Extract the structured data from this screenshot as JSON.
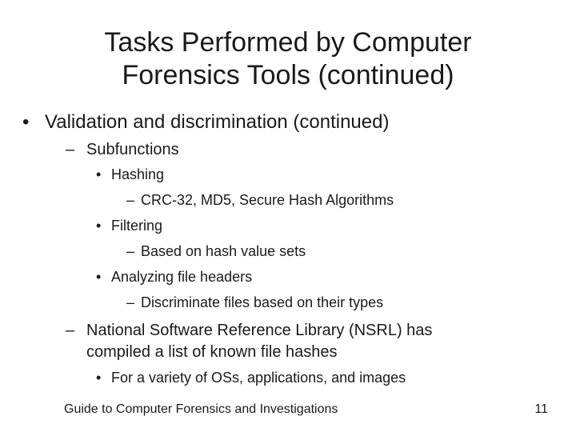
{
  "slide": {
    "title_lines": [
      "Tasks Performed by Computer",
      "Forensics Tools (continued)"
    ],
    "bullets": {
      "b1": {
        "marker": "•",
        "text": "Validation and discrimination (continued)"
      },
      "b1_1": {
        "marker": "–",
        "text": "Subfunctions"
      },
      "b1_1_1": {
        "marker": "•",
        "text": "Hashing"
      },
      "b1_1_1_1": {
        "marker": "–",
        "text": "CRC-32, MD5, Secure Hash Algorithms"
      },
      "b1_1_2": {
        "marker": "•",
        "text": "Filtering"
      },
      "b1_1_2_1": {
        "marker": "–",
        "text": "Based on hash value sets"
      },
      "b1_1_3": {
        "marker": "•",
        "text": "Analyzing file headers"
      },
      "b1_1_3_1": {
        "marker": "–",
        "text": "Discriminate files based on their types"
      },
      "b1_2": {
        "marker": "–",
        "text_lines": [
          "National Software Reference Library (NSRL) has",
          "compiled a list of known file hashes"
        ]
      },
      "b1_2_1": {
        "marker": "•",
        "text": "For a variety of OSs, applications, and images"
      }
    },
    "footer": {
      "book_title": "Guide to Computer Forensics and Investigations",
      "page_number": "11"
    }
  }
}
